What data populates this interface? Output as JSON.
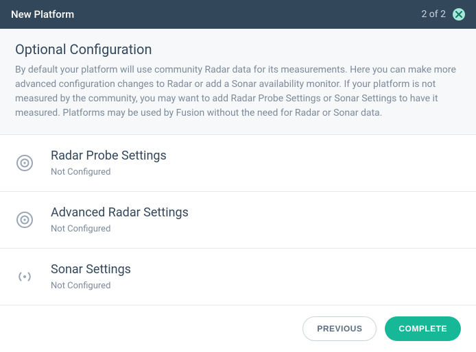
{
  "header": {
    "title": "New Platform",
    "step": "2 of 2"
  },
  "intro": {
    "heading": "Optional Configuration",
    "body": "By default your platform will use community Radar data for its measurements. Here you can make more advanced configuration changes to Radar or add a Sonar availability monitor. If your platform is not measured by the community, you may want to add Radar Probe Settings or Sonar Settings to have it measured. Platforms may be used by Fusion without the need for Radar or Sonar data."
  },
  "rows": [
    {
      "title": "Radar Probe Settings",
      "status": "Not Configured"
    },
    {
      "title": "Advanced Radar Settings",
      "status": "Not Configured"
    },
    {
      "title": "Sonar Settings",
      "status": "Not Configured"
    }
  ],
  "buttons": {
    "previous": "PREVIOUS",
    "complete": "COMPLETE"
  }
}
